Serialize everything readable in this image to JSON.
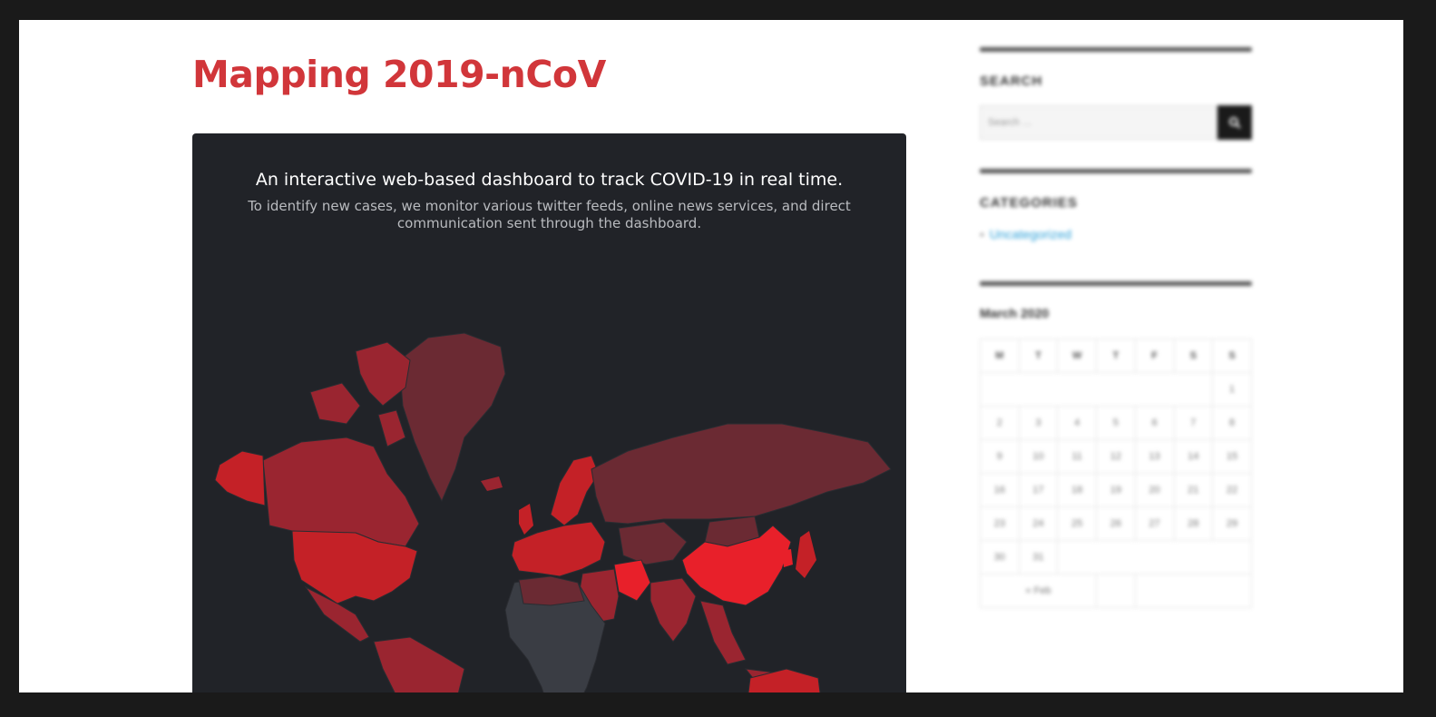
{
  "page": {
    "title": "Mapping 2019-nCoV"
  },
  "dashboard": {
    "heading": "An interactive web-based dashboard to track COVID-19 in real time.",
    "subheading": "To identify new cases, we monitor various twitter feeds, online news services, and direct communication sent through the dashboard.",
    "colors": {
      "background": "#212328",
      "highest": "#e8202a",
      "high": "#c42127",
      "medium": "#9a2530",
      "low": "#6b2a33",
      "none": "#3a3d44"
    }
  },
  "sidebar": {
    "search": {
      "title": "SEARCH",
      "placeholder": "Search …",
      "button_icon": "search-icon"
    },
    "categories": {
      "title": "CATEGORIES",
      "items": [
        "Uncategorized"
      ]
    },
    "calendar": {
      "title": "March 2020",
      "weekdays": [
        "M",
        "T",
        "W",
        "T",
        "F",
        "S",
        "S"
      ],
      "weeks": [
        [
          "",
          "",
          "",
          "",
          "",
          "",
          "1"
        ],
        [
          "2",
          "3",
          "4",
          "5",
          "6",
          "7",
          "8"
        ],
        [
          "9",
          "10",
          "11",
          "12",
          "13",
          "14",
          "15"
        ],
        [
          "16",
          "17",
          "18",
          "19",
          "20",
          "21",
          "22"
        ],
        [
          "23",
          "24",
          "25",
          "26",
          "27",
          "28",
          "29"
        ],
        [
          "30",
          "31",
          "",
          "",
          "",
          "",
          ""
        ]
      ],
      "prev_label": "« Feb"
    }
  }
}
